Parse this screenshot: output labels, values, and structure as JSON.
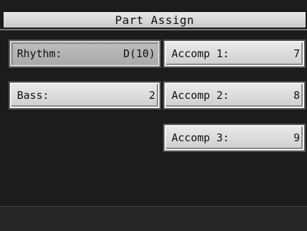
{
  "header": {
    "title": "Part Assign"
  },
  "parts": [
    {
      "label": "Rhythm:",
      "value": "D(10)",
      "selected": true
    },
    {
      "label": "Accomp 1:",
      "value": "7"
    },
    {
      "label": "Bass:",
      "value": "2"
    },
    {
      "label": "Accomp 2:",
      "value": "8"
    },
    {
      "label": "Accomp 3:",
      "value": "9"
    }
  ]
}
